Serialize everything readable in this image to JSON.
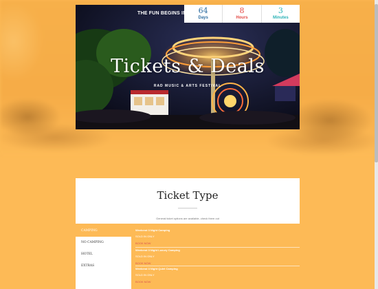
{
  "hero": {
    "countdown_label": "THE FUN BEGINS IN",
    "countdown": [
      {
        "value": "64",
        "unit": "Days"
      },
      {
        "value": "8",
        "unit": "Hours"
      },
      {
        "value": "3",
        "unit": "Minutes"
      }
    ],
    "title": "Tickets & Deals",
    "subtitle": "RAD MUSIC & ARTS FESTIVAL"
  },
  "ticket_section": {
    "title": "Ticket Type",
    "description": "General ticket options are available, check them out"
  },
  "tabs": [
    {
      "label": "CAMPING",
      "active": true
    },
    {
      "label": "NO CAMPING",
      "active": false
    },
    {
      "label": "HOTEL",
      "active": false
    },
    {
      "label": "EXTRAS",
      "active": false
    }
  ],
  "listings": [
    {
      "name": "Weekend 3 Night Camping",
      "status": "SOLD IN ONLY",
      "link": "BOOK NOW"
    },
    {
      "name": "Weekend 3 Night Luxury Camping",
      "status": "SOLD IN ONLY",
      "link": "BOOK NOW"
    },
    {
      "name": "Weekend 3 Night Quiet Camping",
      "status": "SOLD IN ONLY",
      "link": "BOOK NOW"
    }
  ],
  "colors": {
    "page_background": "#fdba56",
    "days": "#2e6da0",
    "hours": "#e34b47",
    "minutes": "#2cb3b7",
    "book_link": "#d9534f"
  }
}
